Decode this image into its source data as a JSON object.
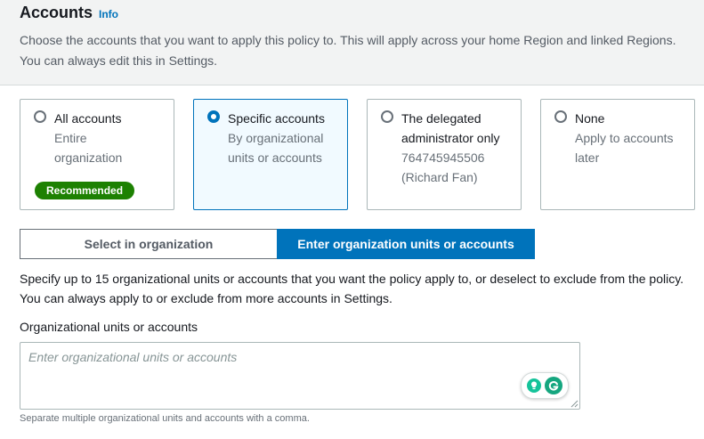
{
  "header": {
    "title": "Accounts",
    "info_link": "Info",
    "description": "Choose the accounts that you want to apply this policy to. This will apply across your home Region and linked Regions. You can always edit this in Settings."
  },
  "options": [
    {
      "label": "All accounts",
      "desc_lines": [
        "Entire",
        "organization"
      ],
      "badge": "Recommended",
      "selected": false
    },
    {
      "label": "Specific accounts",
      "desc_lines": [
        "By organizational",
        "units or accounts"
      ],
      "selected": true
    },
    {
      "label_lines": [
        "The delegated",
        "administrator only"
      ],
      "desc_lines": [
        "764745945506",
        "(Richard Fan)"
      ],
      "selected": false
    },
    {
      "label": "None",
      "desc_lines": [
        "Apply to accounts",
        "later"
      ],
      "selected": false
    }
  ],
  "segmented": {
    "left": "Select in organization",
    "right": "Enter organization units or accounts",
    "active": "right"
  },
  "specify_text": "Specify up to 15 organizational units or accounts that you want the policy apply to, or deselect to exclude from the policy. You can always apply to or exclude from more accounts in Settings.",
  "field": {
    "label": "Organizational units or accounts",
    "placeholder": "Enter organizational units or accounts",
    "hint": "Separate multiple organizational units and accounts with a comma."
  },
  "colors": {
    "accent": "#0073bb",
    "badge_green": "#1d8102",
    "header_bg": "#f2f3f3"
  },
  "icons": [
    "bulb-icon",
    "grammarly-icon",
    "resize-handle-icon"
  ]
}
